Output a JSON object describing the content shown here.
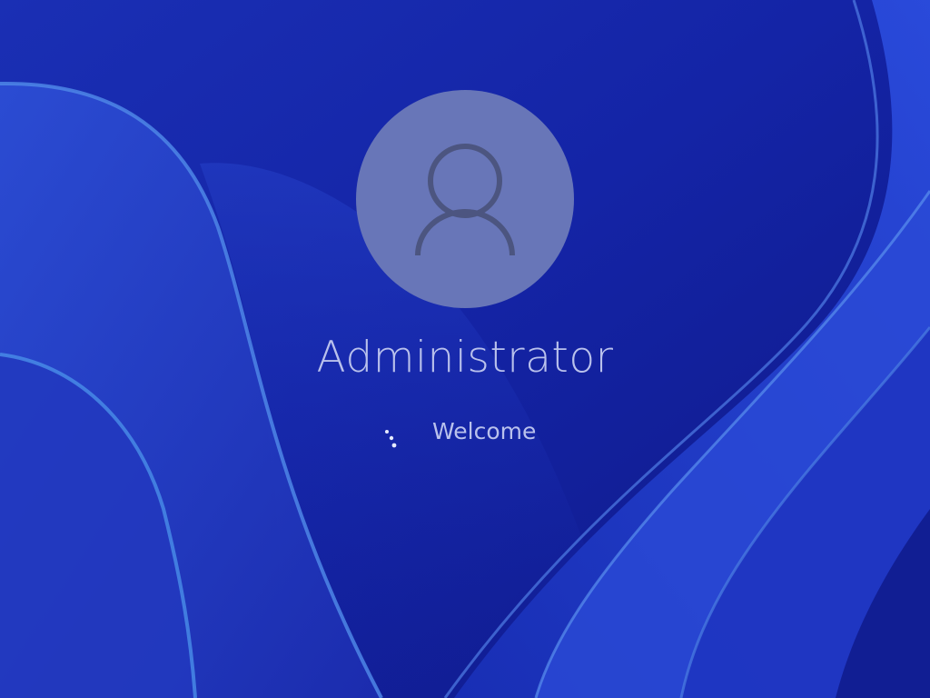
{
  "screen": {
    "user": {
      "name": "Administrator",
      "avatar_icon": "user-silhouette-icon"
    },
    "status": {
      "text": "Welcome",
      "spinner_icon": "loading-dots-icon"
    },
    "colors": {
      "background": "#1622a8",
      "avatar_circle": "#6876b8",
      "avatar_glyph": "#4c5580",
      "text": "#b9c1ec",
      "spinner": "#e6ebff"
    }
  }
}
